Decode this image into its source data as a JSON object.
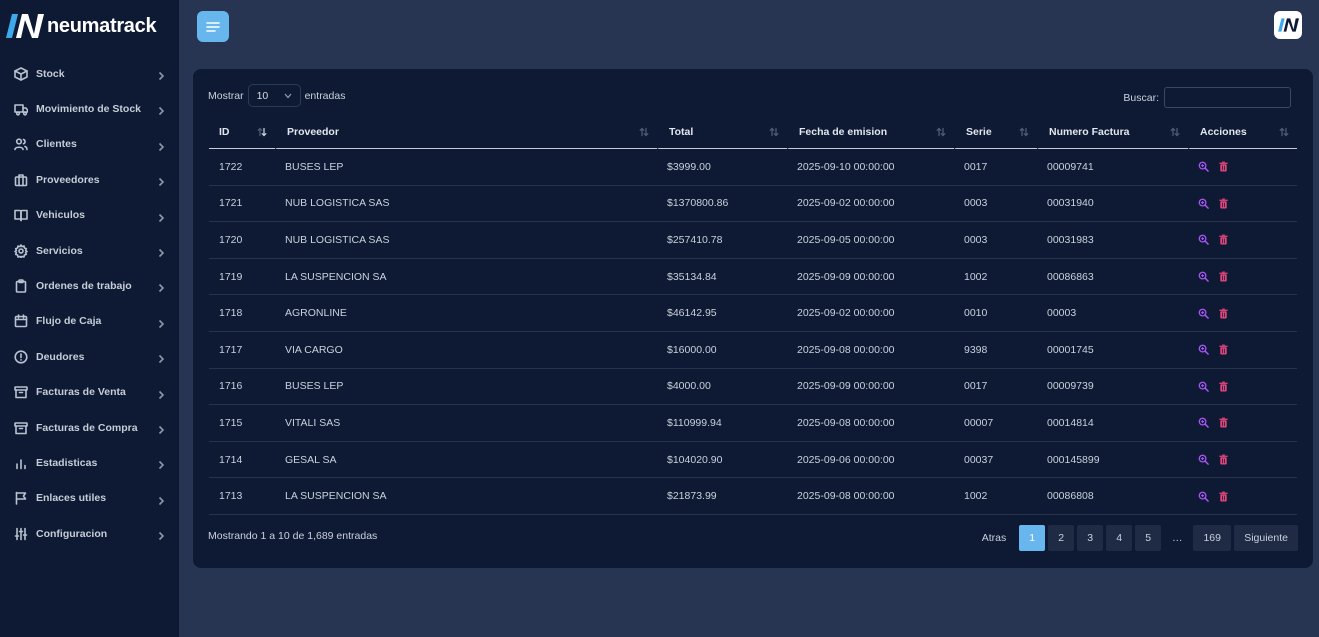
{
  "brand": {
    "name": "neumatrack"
  },
  "sidebar": {
    "items": [
      {
        "label": "Stock",
        "icon": "box-icon"
      },
      {
        "label": "Movimiento de Stock",
        "icon": "truck-icon"
      },
      {
        "label": "Clientes",
        "icon": "users-icon"
      },
      {
        "label": "Proveedores",
        "icon": "building-icon"
      },
      {
        "label": "Vehiculos",
        "icon": "book-icon"
      },
      {
        "label": "Servicios",
        "icon": "gear-icon"
      },
      {
        "label": "Ordenes de trabajo",
        "icon": "clipboard-icon"
      },
      {
        "label": "Flujo de Caja",
        "icon": "calendar-icon"
      },
      {
        "label": "Deudores",
        "icon": "alert-circle-icon"
      },
      {
        "label": "Facturas de Venta",
        "icon": "archive-icon"
      },
      {
        "label": "Facturas de Compra",
        "icon": "archive-icon"
      },
      {
        "label": "Estadisticas",
        "icon": "bar-chart-icon"
      },
      {
        "label": "Enlaces utiles",
        "icon": "flag-icon"
      },
      {
        "label": "Configuracion",
        "icon": "sliders-icon"
      }
    ]
  },
  "toolbar": {
    "menu_icon": "menu-lines-icon"
  },
  "table_controls": {
    "show_label": "Mostrar",
    "page_size": "10",
    "entries_label": "entradas",
    "search_label": "Buscar:",
    "search_value": ""
  },
  "table": {
    "columns": [
      "ID",
      "Proveedor",
      "Total",
      "Fecha de emision",
      "Serie",
      "Numero Factura",
      "Acciones"
    ],
    "rows": [
      [
        "1722",
        "BUSES LEP",
        "$3999.00",
        "2025-09-10 00:00:00",
        "0017",
        "00009741"
      ],
      [
        "1721",
        "NUB LOGISTICA SAS",
        "$1370800.86",
        "2025-09-02 00:00:00",
        "0003",
        "00031940"
      ],
      [
        "1720",
        "NUB LOGISTICA SAS",
        "$257410.78",
        "2025-09-05 00:00:00",
        "0003",
        "00031983"
      ],
      [
        "1719",
        "LA SUSPENCION SA",
        "$35134.84",
        "2025-09-09 00:00:00",
        "1002",
        "00086863"
      ],
      [
        "1718",
        "AGRONLINE",
        "$46142.95",
        "2025-09-02 00:00:00",
        "0010",
        "00003"
      ],
      [
        "1717",
        "VIA CARGO",
        "$16000.00",
        "2025-09-08 00:00:00",
        "9398",
        "00001745"
      ],
      [
        "1716",
        "BUSES LEP",
        "$4000.00",
        "2025-09-09 00:00:00",
        "0017",
        "00009739"
      ],
      [
        "1715",
        "VITALI SAS",
        "$110999.94",
        "2025-09-08 00:00:00",
        "00007",
        "00014814"
      ],
      [
        "1714",
        "GESAL SA",
        "$104020.90",
        "2025-09-06 00:00:00",
        "00037",
        "000145899"
      ],
      [
        "1713",
        "LA SUSPENCION SA",
        "$21873.99",
        "2025-09-08 00:00:00",
        "1002",
        "00086808"
      ]
    ]
  },
  "footer": {
    "info": "Mostrando 1 a 10 de 1,689 entradas",
    "prev_label": "Atras",
    "pages": [
      "1",
      "2",
      "3",
      "4",
      "5"
    ],
    "ellipsis": "…",
    "last_page": "169",
    "next_label": "Siguiente",
    "active_page": "1"
  },
  "colors": {
    "background": "#283552",
    "sidebar": "#0e1a33",
    "accent": "#67b7ee",
    "view_icon": "#a855f7",
    "delete_icon": "#e0457b"
  }
}
